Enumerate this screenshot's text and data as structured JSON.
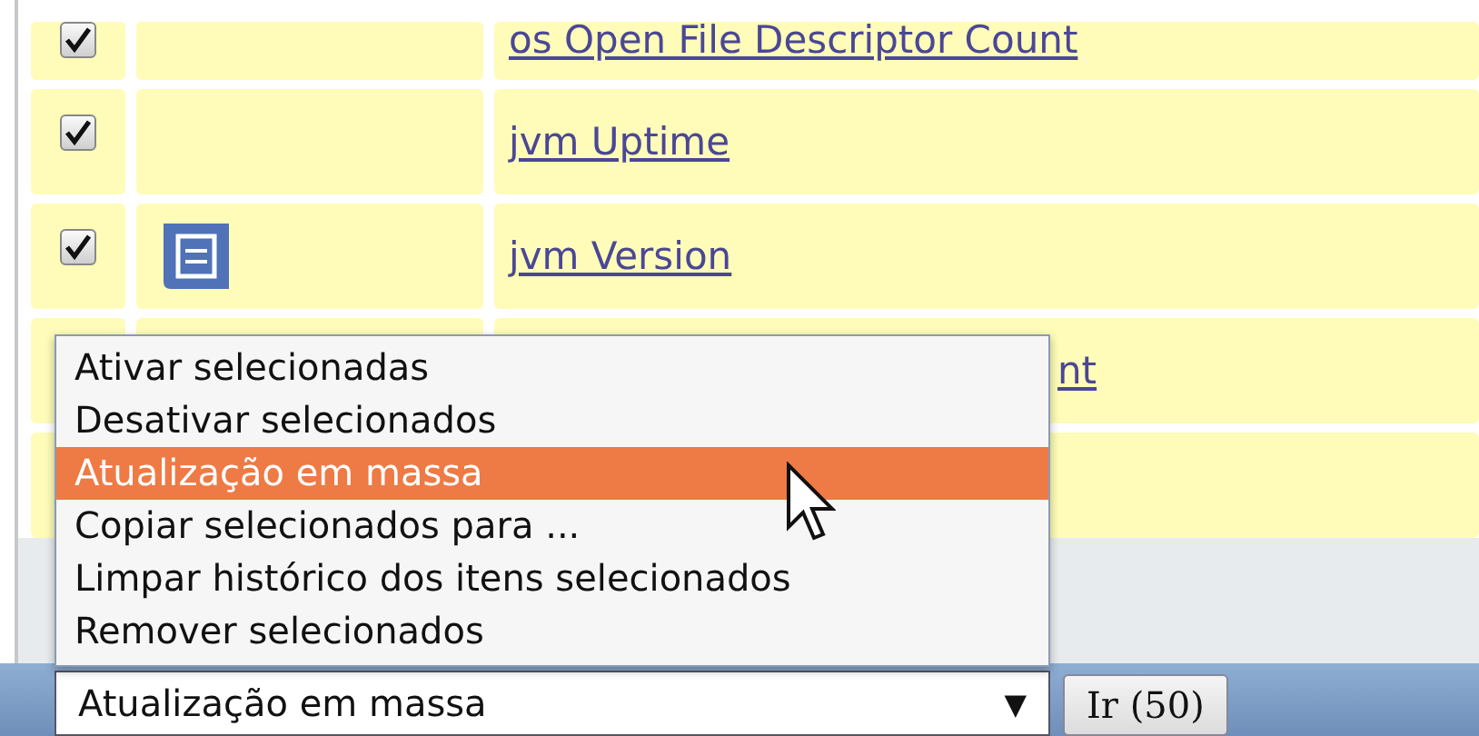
{
  "table": {
    "rows": [
      {
        "checked": true,
        "has_icon": false,
        "name": "os Open File Descriptor Count"
      },
      {
        "checked": true,
        "has_icon": false,
        "name": "jvm Uptime"
      },
      {
        "checked": true,
        "has_icon": true,
        "name": "jvm Version"
      },
      {
        "hidden_under_menu": true,
        "name": "nt"
      },
      {}
    ]
  },
  "action_menu": {
    "options": [
      {
        "label": "Ativar selecionadas",
        "selected": false
      },
      {
        "label": "Desativar selecionados",
        "selected": false
      },
      {
        "label": "Atualização em massa",
        "selected": true
      },
      {
        "label": "Copiar selecionados para ...",
        "selected": false
      },
      {
        "label": "Limpar histórico dos itens selecionados",
        "selected": false
      },
      {
        "label": "Remover selecionados",
        "selected": false
      }
    ]
  },
  "action_select": {
    "value": "Atualização em massa",
    "arrow": "▼"
  },
  "go_button": {
    "label": "Ir (50)"
  }
}
